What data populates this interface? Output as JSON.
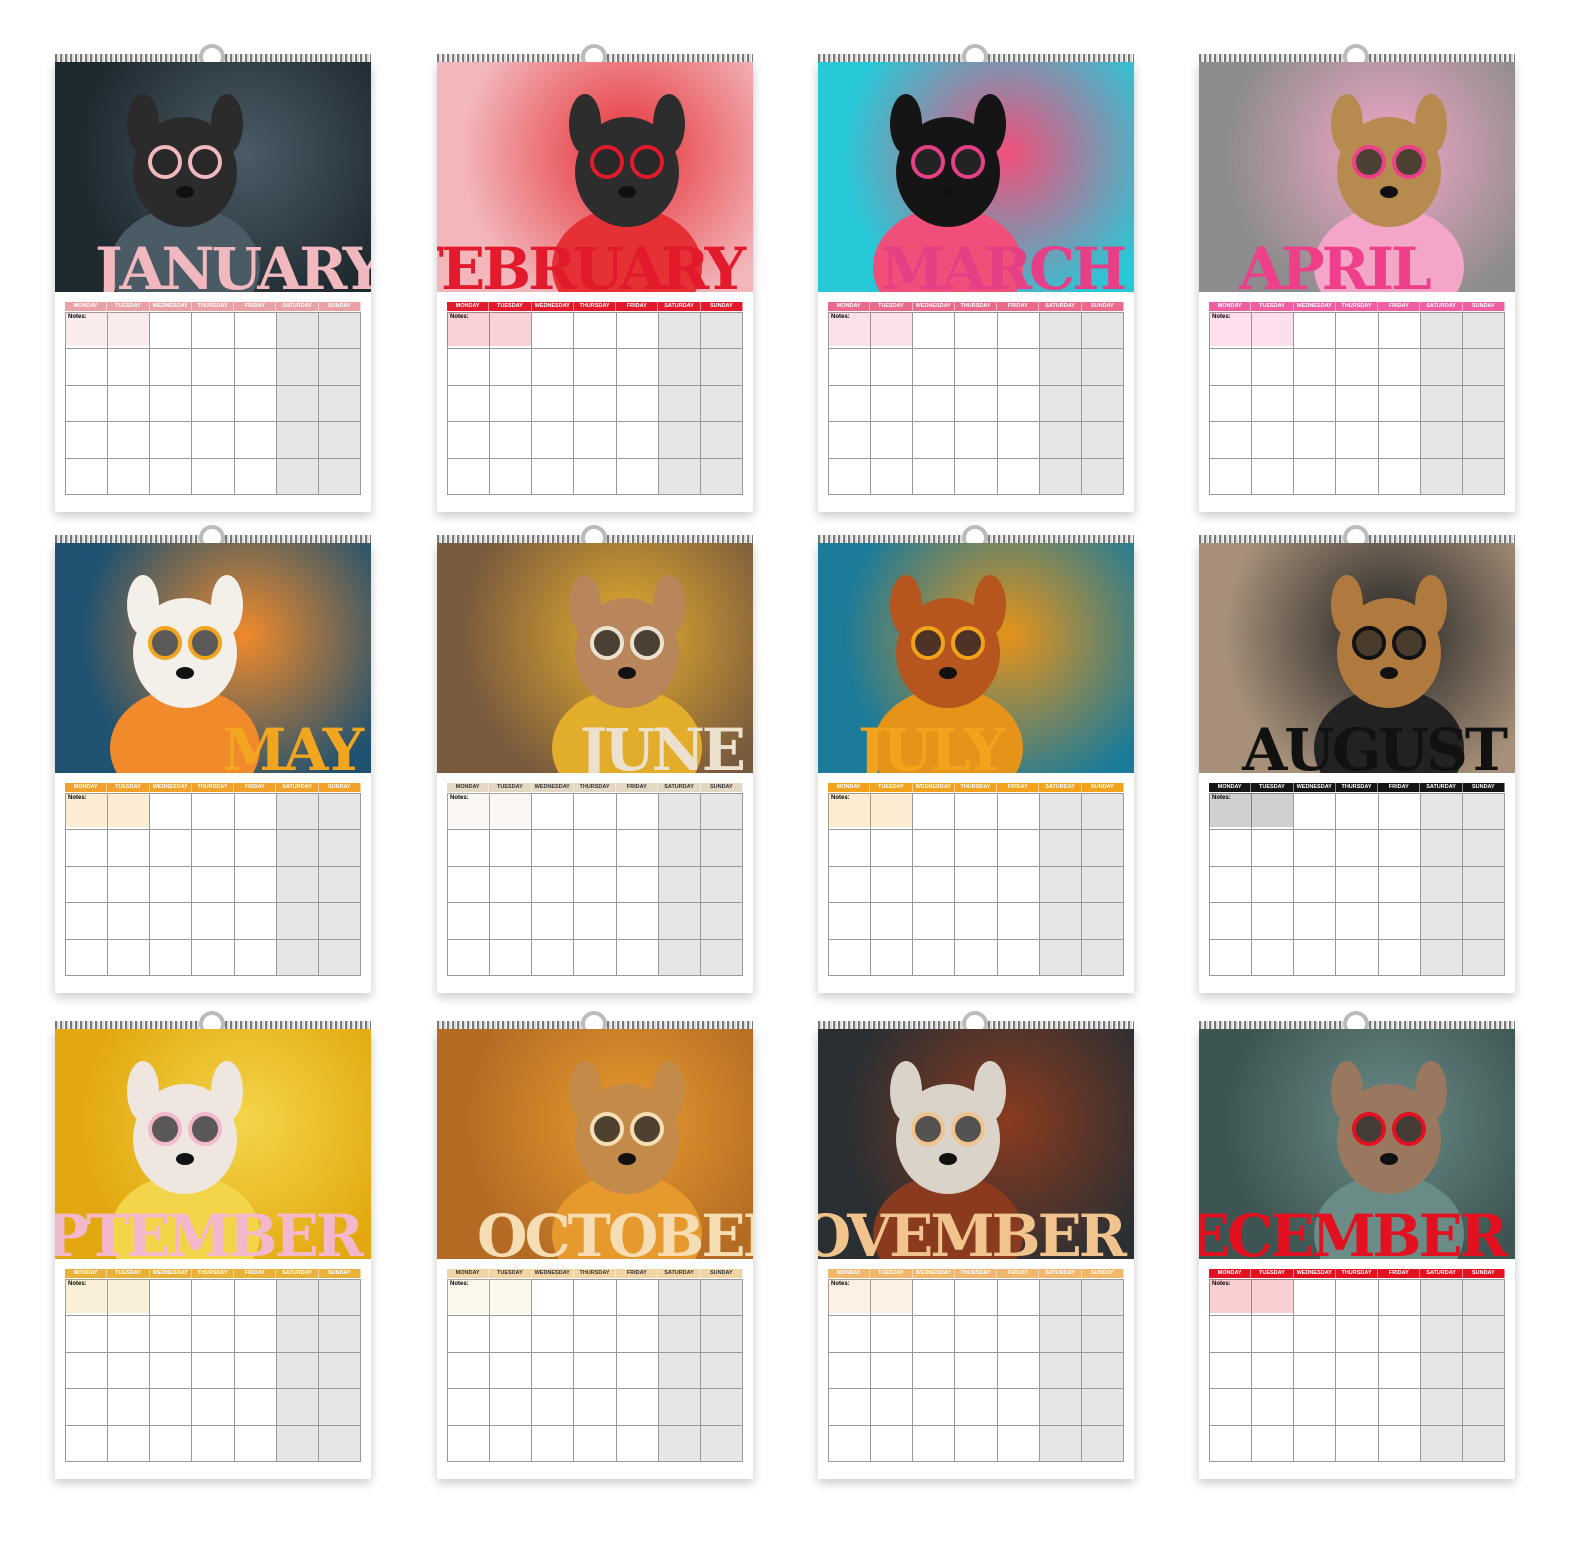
{
  "weekdays": [
    "MONDAY",
    "TUESDAY",
    "WEDNESDAY",
    "THURSDAY",
    "FRIDAY",
    "SATURDAY",
    "SUNDAY"
  ],
  "notes_label": "Notes:",
  "months": [
    {
      "name": "JANUARY",
      "bg": "#1f2a30",
      "text": "#f1b9bd",
      "header": "#e8a2a6",
      "dog": "#2b2b2b",
      "accent": "#4a5b66"
    },
    {
      "name": "FEBRUARY",
      "bg": "#f2b6bb",
      "text": "#e21a2b",
      "header": "#e21a2b",
      "dog": "#2d2d2d",
      "accent": "#e53035"
    },
    {
      "name": "MARCH",
      "bg": "#27c9d8",
      "text": "#e53f86",
      "header": "#e96a8a",
      "dog": "#151515",
      "accent": "#f04f7a"
    },
    {
      "name": "APRIL",
      "bg": "#8c8c8c",
      "text": "#ef3f8b",
      "header": "#ef5ea0",
      "dog": "#b78b4f",
      "accent": "#f3a6c8"
    },
    {
      "name": "MAY",
      "bg": "#1f5170",
      "text": "#f2a51f",
      "header": "#f2a12a",
      "dog": "#f3efe9",
      "accent": "#f08a2b"
    },
    {
      "name": "JUNE",
      "bg": "#7a5a3e",
      "text": "#ece1cf",
      "header": "#e4d7c3",
      "dog": "#b9855a",
      "accent": "#e3ad2c"
    },
    {
      "name": "JULY",
      "bg": "#1c7b99",
      "text": "#f2a21b",
      "header": "#f2a21b",
      "dog": "#b6551e",
      "accent": "#e6931a"
    },
    {
      "name": "AUGUST",
      "bg": "#a69079",
      "text": "#111111",
      "header": "#151515",
      "dog": "#b07a3f",
      "accent": "#222222"
    },
    {
      "name": "SEPTEMBER",
      "bg": "#e3a80f",
      "text": "#f4b8cc",
      "header": "#e8b23a",
      "dog": "#efe6df",
      "accent": "#f3d54a"
    },
    {
      "name": "OCTOBER",
      "bg": "#b36b24",
      "text": "#f6ddb4",
      "header": "#f2d5a7",
      "dog": "#c48a4a",
      "accent": "#e69a2d"
    },
    {
      "name": "NOVEMBER",
      "bg": "#2a2f33",
      "text": "#f1c38d",
      "header": "#f1b76c",
      "dog": "#d9d3ca",
      "accent": "#8a3b1f"
    },
    {
      "name": "DECEMBER",
      "bg": "#3d5552",
      "text": "#e3111f",
      "header": "#e3111f",
      "dog": "#9a7860",
      "accent": "#6a8b86"
    }
  ]
}
